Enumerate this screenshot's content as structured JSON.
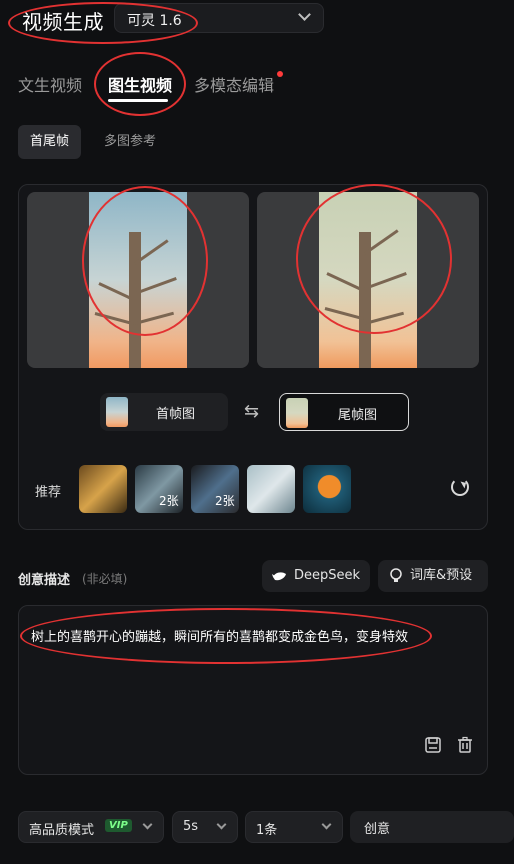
{
  "header": {
    "title": "视频生成",
    "model": "可灵 1.6"
  },
  "tabs": [
    {
      "label": "文生视频"
    },
    {
      "label": "图生视频"
    },
    {
      "label": "多模态编辑"
    }
  ],
  "subtabs": [
    {
      "label": "首尾帧"
    },
    {
      "label": "多图参考"
    }
  ],
  "frames": {
    "first_label": "首帧图",
    "last_label": "尾帧图",
    "swap_icon": "swap-icon"
  },
  "recommend": {
    "label": "推荐",
    "items": [
      {
        "badge": ""
      },
      {
        "badge": "2张"
      },
      {
        "badge": "2张"
      },
      {
        "badge": ""
      },
      {
        "badge": ""
      }
    ]
  },
  "description": {
    "label": "创意描述",
    "note": "(非必填)",
    "deepseek": "DeepSeek",
    "library": "词库&预设",
    "text": "树上的喜鹊开心的蹦越，瞬间所有的喜鹊都变成金色鸟，变身特效"
  },
  "bottom": {
    "mode": "高品质模式",
    "vip": "VIP",
    "duration": "5s",
    "count": "1条",
    "create": "创意"
  },
  "colors": {
    "annotation": "#e23232",
    "accent": "#ffffff",
    "vip": "#7cff8a"
  }
}
